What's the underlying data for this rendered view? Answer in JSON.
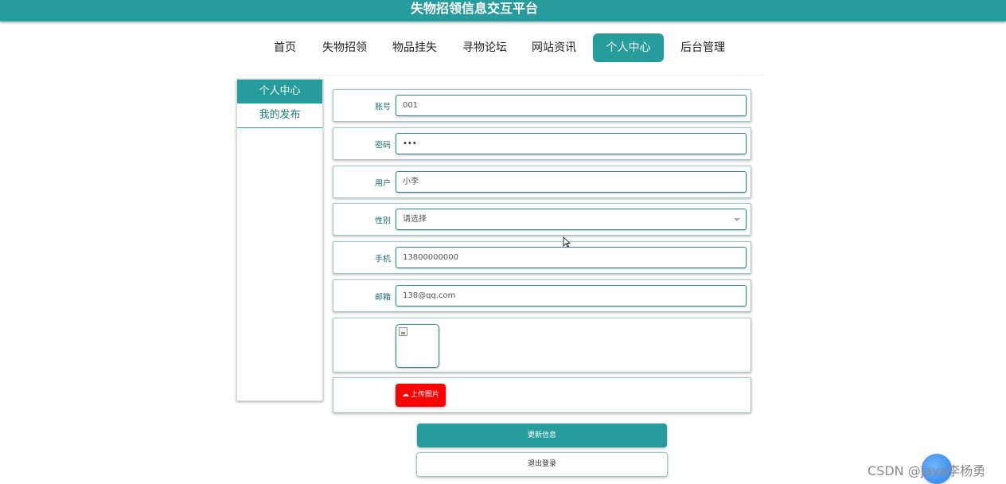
{
  "header": {
    "title": "失物招领信息交互平台"
  },
  "nav": {
    "items": [
      {
        "label": "首页"
      },
      {
        "label": "失物招领"
      },
      {
        "label": "物品挂失"
      },
      {
        "label": "寻物论坛"
      },
      {
        "label": "网站资讯"
      },
      {
        "label": "个人中心",
        "active": true
      },
      {
        "label": "后台管理"
      }
    ]
  },
  "sidebar": {
    "title": "个人中心",
    "items": [
      {
        "label": "我的发布"
      }
    ]
  },
  "form": {
    "account": {
      "label": "账号",
      "value": "001"
    },
    "password": {
      "label": "密码",
      "value": "•••"
    },
    "user": {
      "label": "用户",
      "value": "小李"
    },
    "gender": {
      "label": "性别",
      "placeholder": "请选择"
    },
    "phone": {
      "label": "手机",
      "value": "13800000000"
    },
    "email": {
      "label": "邮箱",
      "value": "138@qq.com"
    },
    "upload_label": "上传图片"
  },
  "actions": {
    "update_label": "更新信息",
    "logout_label": "退出登录"
  },
  "watermark": "CSDN @java李杨勇",
  "colors": {
    "primary": "#269c9c",
    "upload": "#ff0000"
  }
}
